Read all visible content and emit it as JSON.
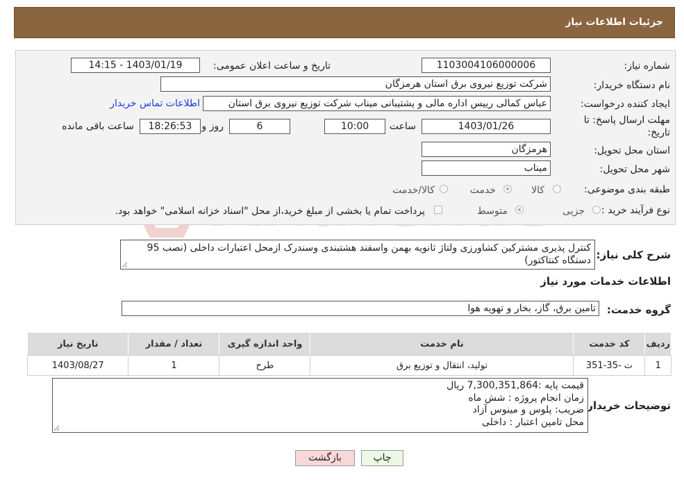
{
  "page_title": "جزئیات اطلاعات نیاز",
  "fields": {
    "need_number_label": "شماره نیاز:",
    "need_number": "1103004106000006",
    "announce_label": "تاریخ و ساعت اعلان عمومی:",
    "announce_value": "1403/01/19 - 14:15",
    "buyer_org_label": "نام دستگاه خریدار:",
    "buyer_org": "شرکت توزیع نیروی برق استان هرمزگان",
    "creator_label": "ایجاد کننده درخواست:",
    "creator": "عباس کمالی رییس اداره مالی و پشتیبانی میناب شرکت توزیع نیروی برق استان",
    "contact_link": "اطلاعات تماس خریدار",
    "deadline_label_1": "مهلت ارسال پاسخ: تا",
    "deadline_label_2": "تاریخ:",
    "deadline_date": "1403/01/26",
    "hour_label": "ساعت",
    "deadline_time": "10:00",
    "days_value": "6",
    "days_label": "روز و",
    "remaining_time": "18:26:53",
    "remaining_label": "ساعت باقی مانده",
    "province_label": "استان محل تحویل:",
    "province": "هرمزگان",
    "city_label": "شهر محل تحویل:",
    "city": "میناب",
    "category_label": "طبقه بندی موضوعی:",
    "category_options": [
      "کالا",
      "خدمت",
      "کالا/خدمت"
    ],
    "process_label": "نوع فرآیند خرید :",
    "process_options": [
      "جزیی",
      "متوسط"
    ],
    "payment_note": "پرداخت تمام یا بخشی از مبلغ خرید،از محل \"اسناد خزانه اسلامی\" خواهد بود."
  },
  "summary": {
    "label": "شرح کلی نیاز:",
    "text": "کنترل پذیری مشترکین کشاورزی ولتاژ ثانویه بهمن واسفند هشتبندی وسندرک ازمحل اعتبارات داخلی (نصب 95 دستگاه کنتاکتور)"
  },
  "services_heading": "اطلاعات خدمات مورد نیاز",
  "service_group": {
    "label": "گروه خدمت:",
    "value": "تامین برق، گاز، بخار و تهویه هوا"
  },
  "table": {
    "headers": [
      "ردیف",
      "کد خدمت",
      "نام خدمت",
      "واحد اندازه گیری",
      "تعداد / مقدار",
      "تاریخ نیاز"
    ],
    "rows": [
      [
        "1",
        "ت -35-351",
        "تولید، انتقال و توزیع برق",
        "طرح",
        "1",
        "1403/08/27"
      ]
    ]
  },
  "buyer_notes": {
    "label": "توضیحات خریدار:",
    "lines": [
      "قیمت پایه :7,300,351,864 ریال",
      "زمان انجام پروژه : شش ماه",
      "ضریب: پلوس و مینوس آزاد",
      "محل تامین اعتبار : داخلی"
    ]
  },
  "buttons": {
    "print": "چاپ",
    "back": "بازگشت"
  },
  "colors": {
    "title_bg": "#8a6540",
    "link": "#1a3fd8",
    "back_bg": "#f8d7d7",
    "print_bg": "#ecf9e6"
  }
}
